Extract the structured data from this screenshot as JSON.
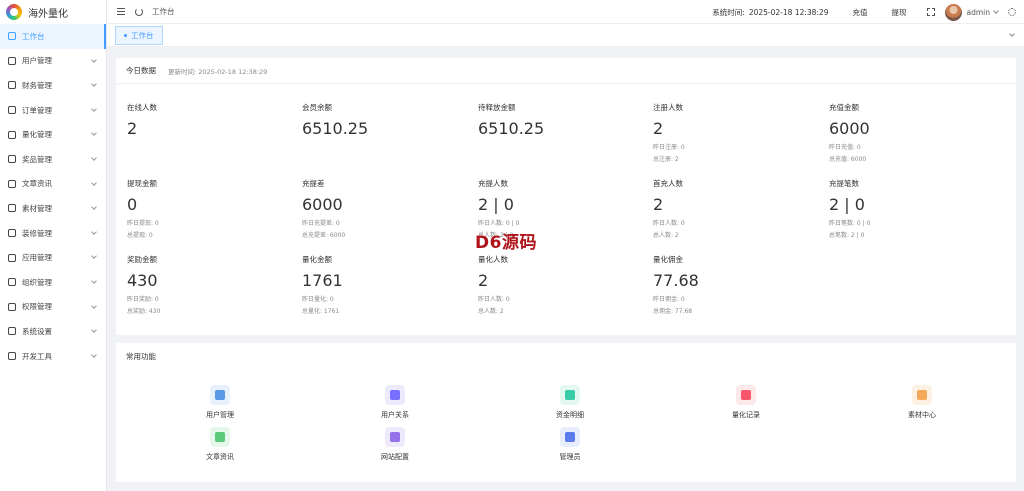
{
  "app": {
    "name": "海外量化"
  },
  "sidebar": {
    "items": [
      {
        "label": "工作台",
        "active": true,
        "expandable": false
      },
      {
        "label": "用户管理",
        "expandable": true
      },
      {
        "label": "财务管理",
        "expandable": true
      },
      {
        "label": "订单管理",
        "expandable": true
      },
      {
        "label": "量化管理",
        "expandable": true
      },
      {
        "label": "奖品管理",
        "expandable": true
      },
      {
        "label": "文章资讯",
        "expandable": true
      },
      {
        "label": "素材管理",
        "expandable": true
      },
      {
        "label": "装修管理",
        "expandable": true
      },
      {
        "label": "应用管理",
        "expandable": true
      },
      {
        "label": "组织管理",
        "expandable": true
      },
      {
        "label": "权限管理",
        "expandable": true
      },
      {
        "label": "系统设置",
        "expandable": true
      },
      {
        "label": "开发工具",
        "expandable": true
      }
    ]
  },
  "header": {
    "breadcrumb": "工作台",
    "system_time_label": "系统时间:",
    "system_time": "2025-02-18 12:38:29",
    "recharge": "充值",
    "withdraw": "提现",
    "user": "admin"
  },
  "tabs": [
    {
      "label": "工作台"
    }
  ],
  "today": {
    "title": "今日数据",
    "updated": "更新时间: 2025-02-18 12:38:29",
    "stats": [
      {
        "label": "在线人数",
        "value": "2",
        "subs": []
      },
      {
        "label": "会员余额",
        "value": "6510.25",
        "subs": []
      },
      {
        "label": "待释放金额",
        "value": "6510.25",
        "subs": []
      },
      {
        "label": "注册人数",
        "value": "2",
        "subs": [
          "昨日注册: 0",
          "总注册: 2"
        ]
      },
      {
        "label": "充值金额",
        "value": "6000",
        "subs": [
          "昨日充值: 0",
          "总充值: 6000"
        ]
      },
      {
        "label": "提现金额",
        "value": "0",
        "subs": [
          "昨日提现: 0",
          "总提现: 0"
        ]
      },
      {
        "label": "充提差",
        "value": "6000",
        "subs": [
          "昨日充提差: 0",
          "总充提差: 6000"
        ]
      },
      {
        "label": "充提人数",
        "value": "2 | 0",
        "subs": [
          "昨日人数: 0 | 0",
          "总人数: 2 | 0"
        ]
      },
      {
        "label": "首充人数",
        "value": "2",
        "subs": [
          "昨日人数: 0",
          "总人数: 2"
        ]
      },
      {
        "label": "充提笔数",
        "value": "2 | 0",
        "subs": [
          "昨日笔数: 0 | 0",
          "总笔数: 2 | 0"
        ]
      },
      {
        "label": "奖励金额",
        "value": "430",
        "subs": [
          "昨日奖励: 0",
          "总奖励: 430"
        ]
      },
      {
        "label": "量化金额",
        "value": "1761",
        "subs": [
          "昨日量化: 0",
          "总量化: 1761"
        ]
      },
      {
        "label": "量化人数",
        "value": "2",
        "subs": [
          "昨日人数: 0",
          "总人数: 2"
        ]
      },
      {
        "label": "量化佣金",
        "value": "77.68",
        "subs": [
          "昨日佣金: 0",
          "总佣金: 77.68"
        ]
      }
    ]
  },
  "functions": {
    "title": "常用功能",
    "items": [
      {
        "label": "用户管理",
        "icon": "user-icon",
        "color": "#4a90e2",
        "bg": "#e8f1fc"
      },
      {
        "label": "用户关系",
        "icon": "relation-icon",
        "color": "#6c63ff",
        "bg": "#eceafd"
      },
      {
        "label": "资金明细",
        "icon": "fund-icon",
        "color": "#26c6a0",
        "bg": "#e4f8f2"
      },
      {
        "label": "量化记录",
        "icon": "record-icon",
        "color": "#f5475c",
        "bg": "#fde8ea"
      },
      {
        "label": "素材中心",
        "icon": "material-icon",
        "color": "#f5a04a",
        "bg": "#fdf1e4"
      },
      {
        "label": "文章资讯",
        "icon": "article-icon",
        "color": "#4cc46e",
        "bg": "#e6f7eb"
      },
      {
        "label": "网站配置",
        "icon": "site-config-icon",
        "color": "#8a63e8",
        "bg": "#efe9fc"
      },
      {
        "label": "管理员",
        "icon": "admin-icon",
        "color": "#4a6ee8",
        "bg": "#e8edfc"
      }
    ]
  },
  "watermark": "D6源码"
}
